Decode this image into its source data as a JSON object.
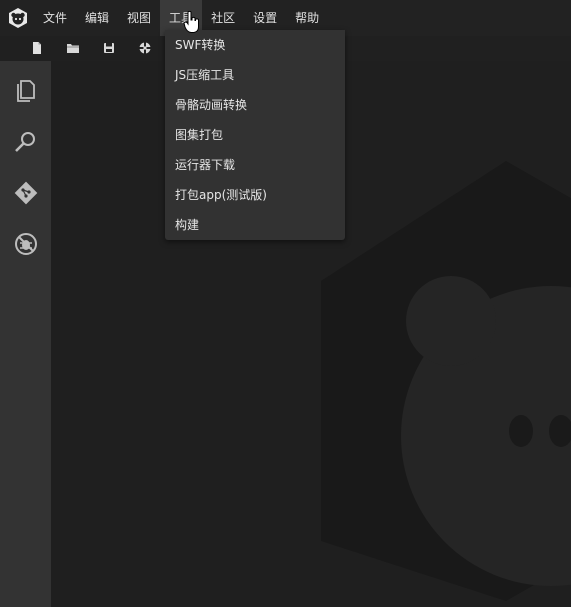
{
  "menubar": {
    "logo_icon": "monkey-logo-icon",
    "items": [
      {
        "label": "文件"
      },
      {
        "label": "编辑"
      },
      {
        "label": "视图"
      },
      {
        "label": "工具"
      },
      {
        "label": "社区"
      },
      {
        "label": "设置"
      },
      {
        "label": "帮助"
      }
    ],
    "active_index": 3
  },
  "toolbar": {
    "buttons": [
      "new-file-icon",
      "open-folder-icon",
      "save-icon",
      "compile-icon"
    ]
  },
  "activitybar": {
    "buttons": [
      "explorer-icon",
      "search-icon",
      "git-icon",
      "debug-icon"
    ]
  },
  "dropdown": {
    "items": [
      {
        "label": "SWF转换"
      },
      {
        "label": "JS压缩工具"
      },
      {
        "label": "骨骼动画转换"
      },
      {
        "label": "图集打包"
      },
      {
        "label": "运行器下载"
      },
      {
        "label": "打包app(测试版)"
      },
      {
        "label": "构建"
      }
    ]
  },
  "colors": {
    "menubar_bg": "#222222",
    "active_menu_bg": "#3a3a3a",
    "dropdown_bg": "#323232",
    "activitybar_bg": "#333333",
    "editor_bg": "#1f1f1f"
  }
}
